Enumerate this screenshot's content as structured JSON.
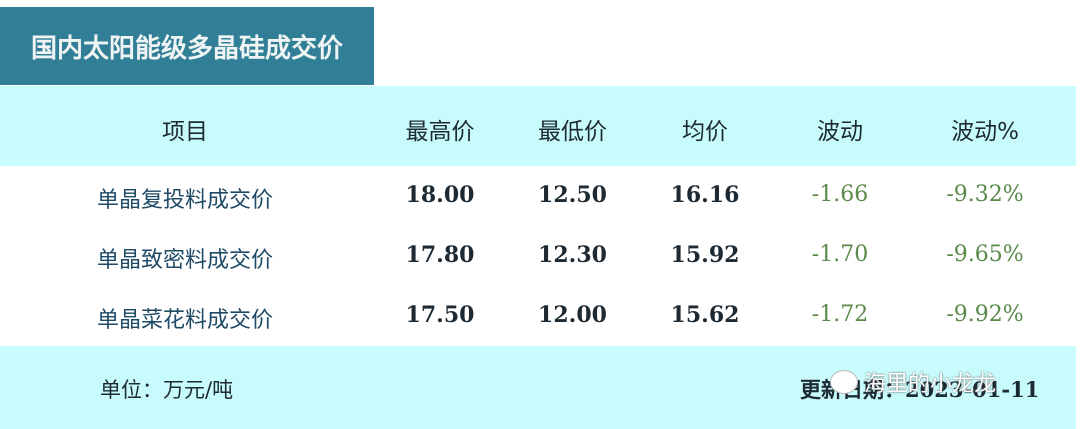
{
  "title": "国内太阳能级多晶硅成交价",
  "columns": [
    "项目",
    "最高价",
    "最低价",
    "均价",
    "波动",
    "波动%"
  ],
  "rows": [
    {
      "name": "单晶复投料成交价",
      "high": "18.00",
      "low": "12.50",
      "avg": "16.16",
      "change": "-1.66",
      "change_pct": "-9.32%"
    },
    {
      "name": "单晶致密料成交价",
      "high": "17.80",
      "low": "12.30",
      "avg": "15.92",
      "change": "-1.70",
      "change_pct": "-9.65%"
    },
    {
      "name": "单晶菜花料成交价",
      "high": "17.50",
      "low": "12.00",
      "avg": "15.62",
      "change": "-1.72",
      "change_pct": "-9.92%"
    }
  ],
  "unit": "单位：万元/吨",
  "updated": "更新日期：2023-01-11",
  "watermark": "海里的小龙龙"
}
